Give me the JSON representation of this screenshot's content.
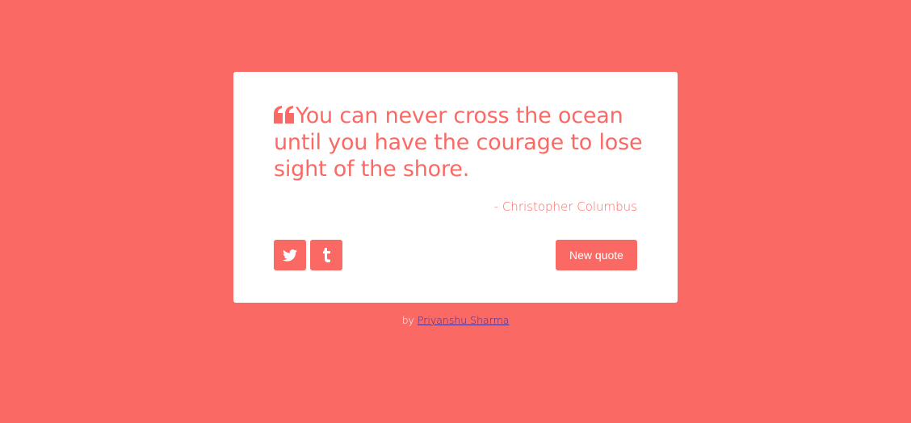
{
  "quote": {
    "text": "You can never cross the ocean until you have the courage to lose sight of the shore.",
    "author": "- Christopher Columbus"
  },
  "actions": {
    "tweet_icon": "twitter-icon",
    "tumblr_icon": "tumblr-icon",
    "new_quote_label": "New quote"
  },
  "footer": {
    "prefix": "by",
    "author_link": "Priyanshu Sharma"
  },
  "colors": {
    "background": "#fb6964",
    "card": "#ffffff",
    "accent": "#fb6964"
  }
}
